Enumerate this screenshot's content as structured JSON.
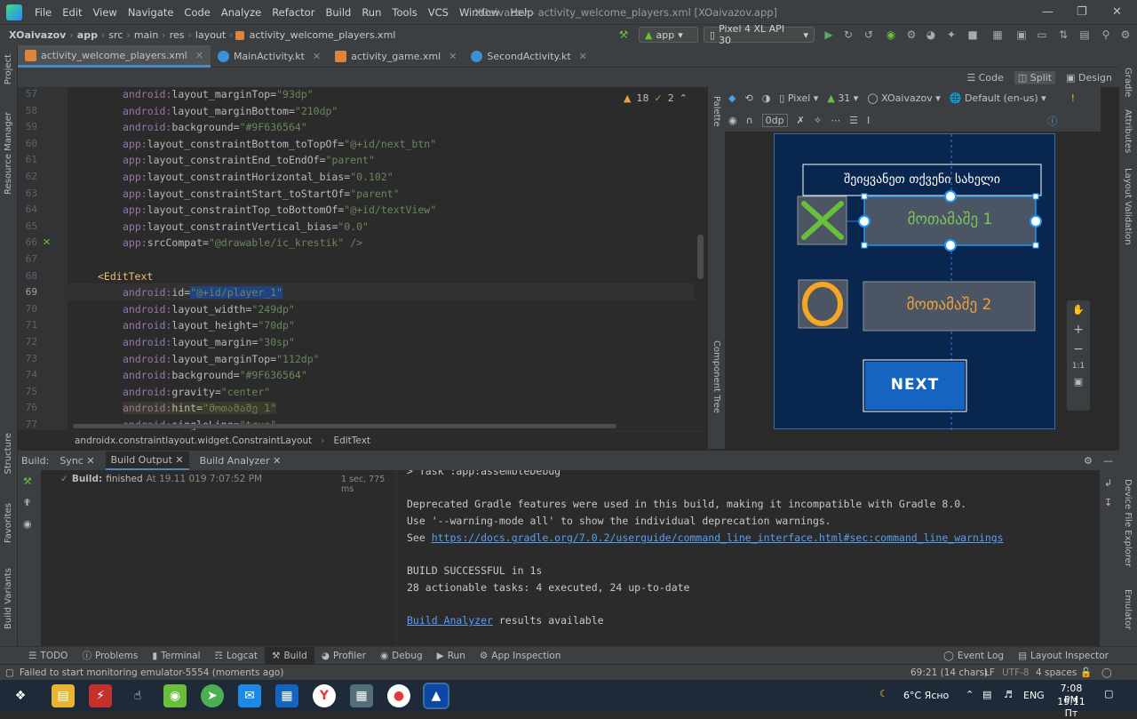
{
  "menu": {
    "items": [
      "File",
      "Edit",
      "View",
      "Navigate",
      "Code",
      "Analyze",
      "Refactor",
      "Build",
      "Run",
      "Tools",
      "VCS",
      "Window",
      "Help"
    ],
    "window_title": "XOaivazov - activity_welcome_players.xml [XOaivazov.app]"
  },
  "nav": {
    "crumbs": [
      "XOaivazov",
      "app",
      "src",
      "main",
      "res",
      "layout",
      "activity_welcome_players.xml"
    ],
    "run_config": "app",
    "device": "Pixel 4 XL API 30"
  },
  "tabs": [
    {
      "label": "activity_welcome_players.xml",
      "color": "#e0843c"
    },
    {
      "label": "MainActivity.kt",
      "color": "#3d8fd6"
    },
    {
      "label": "activity_game.xml",
      "color": "#e0843c"
    },
    {
      "label": "SecondActivity.kt",
      "color": "#3d8fd6"
    }
  ],
  "view_modes": {
    "code": "Code",
    "split": "Split",
    "design": "Design"
  },
  "left_strip": {
    "project": "Project",
    "resource_manager": "Resource Manager",
    "structure": "Structure",
    "favorites": "Favorites",
    "build_variants": "Build Variants"
  },
  "right_strip": {
    "gradle": "Gradle",
    "attributes": "Attributes",
    "layout_validation": "Layout Validation",
    "device_file_explorer": "Device File Explorer",
    "emulator": "Emulator"
  },
  "editor": {
    "line_numbers": [
      "57",
      "58",
      "59",
      "60",
      "61",
      "62",
      "63",
      "64",
      "65",
      "66",
      "67",
      "68",
      "69",
      "70",
      "71",
      "72",
      "73",
      "74",
      "75",
      "76",
      "77"
    ],
    "lines": [
      {
        "ns": "android:",
        "attr": "layout_marginTop",
        "val": "\"93dp\""
      },
      {
        "ns": "android:",
        "attr": "layout_marginBottom",
        "val": "\"210dp\""
      },
      {
        "ns": "android:",
        "attr": "background",
        "val": "\"#9F636564\""
      },
      {
        "ns": "app:",
        "attr": "layout_constraintBottom_toTopOf",
        "val": "\"@+id/next_btn\""
      },
      {
        "ns": "app:",
        "attr": "layout_constraintEnd_toEndOf",
        "val": "\"parent\""
      },
      {
        "ns": "app:",
        "attr": "layout_constraintHorizontal_bias",
        "val": "\"0.102\""
      },
      {
        "ns": "app:",
        "attr": "layout_constraintStart_toStartOf",
        "val": "\"parent\""
      },
      {
        "ns": "app:",
        "attr": "layout_constraintTop_toBottomOf",
        "val": "\"@+id/textView\""
      },
      {
        "ns": "app:",
        "attr": "layout_constraintVertical_bias",
        "val": "\"0.0\""
      },
      {
        "ns": "app:",
        "attr": "srcCompat",
        "val": "\"@drawable/ic_krestik\" />"
      },
      {
        "ns": "",
        "attr": "",
        "val": ""
      },
      {
        "ns": "",
        "attr": "<EditText",
        "val": ""
      },
      {
        "ns": "android:",
        "attr": "id",
        "val": "\"@+id/player_1\""
      },
      {
        "ns": "android:",
        "attr": "layout_width",
        "val": "\"249dp\""
      },
      {
        "ns": "android:",
        "attr": "layout_height",
        "val": "\"70dp\""
      },
      {
        "ns": "android:",
        "attr": "layout_margin",
        "val": "\"30sp\""
      },
      {
        "ns": "android:",
        "attr": "layout_marginTop",
        "val": "\"112dp\""
      },
      {
        "ns": "android:",
        "attr": "background",
        "val": "\"#9F636564\""
      },
      {
        "ns": "android:",
        "attr": "gravity",
        "val": "\"center\""
      },
      {
        "ns": "android:",
        "attr": "hint",
        "val": "\"მოთამაშე 1\""
      },
      {
        "ns": "android:",
        "attr": "singleLine",
        "val": "\"true\""
      }
    ],
    "warnings": "18",
    "weak_warnings": "2"
  },
  "breadcrumb": {
    "parent": "androidx.constraintlayout.widget.ConstraintLayout",
    "child": "EditText"
  },
  "design": {
    "device_dropdown": "Pixel",
    "api_dropdown": "31",
    "theme_dropdown": "XOaivazov",
    "locale_dropdown": "Default (en-us)",
    "margin_value": "0dp",
    "palette_label": "Palette",
    "component_tree_label": "Component Tree",
    "header_text": "შეიყვანეთ თქვენი სახელი",
    "player1_hint": "მოთამაშე 1",
    "player2_hint": "მოთამაშე 2",
    "next_label": "NEXT",
    "zoom_ratio": "1:1",
    "colors": {
      "canvas_bg": "#09264f",
      "field_bg": "#4b5563",
      "button_bg": "#1565c0",
      "x_color": "#6abf3a",
      "o_color": "#f5a623",
      "selection": "#2196f3"
    }
  },
  "build": {
    "tabs": {
      "build": "Build:",
      "sync": "Sync",
      "output": "Build Output",
      "analyzer": "Build Analyzer"
    },
    "status_label": "Build:",
    "status_value": "finished",
    "status_time": "At 19.11 019 7:07:52 PM",
    "duration": "1 sec, 775 ms",
    "output_lines": [
      "> Task :app:assembleDebug",
      "",
      "Deprecated Gradle features were used in this build, making it incompatible with Gradle 8.0.",
      "Use '--warning-mode all' to show the individual deprecation warnings.",
      "See ",
      "",
      "BUILD SUCCESSFUL in 1s",
      "28 actionable tasks: 4 executed, 24 up-to-date",
      "",
      " results available"
    ],
    "see_link": "https://docs.gradle.org/7.0.2/userguide/command_line_interface.html#sec:command_line_warnings",
    "analyzer_link": "Build Analyzer"
  },
  "bottom_tabs": [
    "TODO",
    "Problems",
    "Terminal",
    "Logcat",
    "Build",
    "Profiler",
    "Debug",
    "Run",
    "App Inspection",
    "Event Log",
    "Layout Inspector"
  ],
  "status": {
    "message": "Failed to start monitoring emulator-5554 (moments ago)",
    "position": "69:21 (14 chars)",
    "line_sep": "LF",
    "encoding": "UTF-8",
    "indent": "4 spaces"
  },
  "taskbar": {
    "weather": "6°C Ясно",
    "lang": "ENG",
    "time": "7:08 PM",
    "date": "19.11 Пт"
  }
}
